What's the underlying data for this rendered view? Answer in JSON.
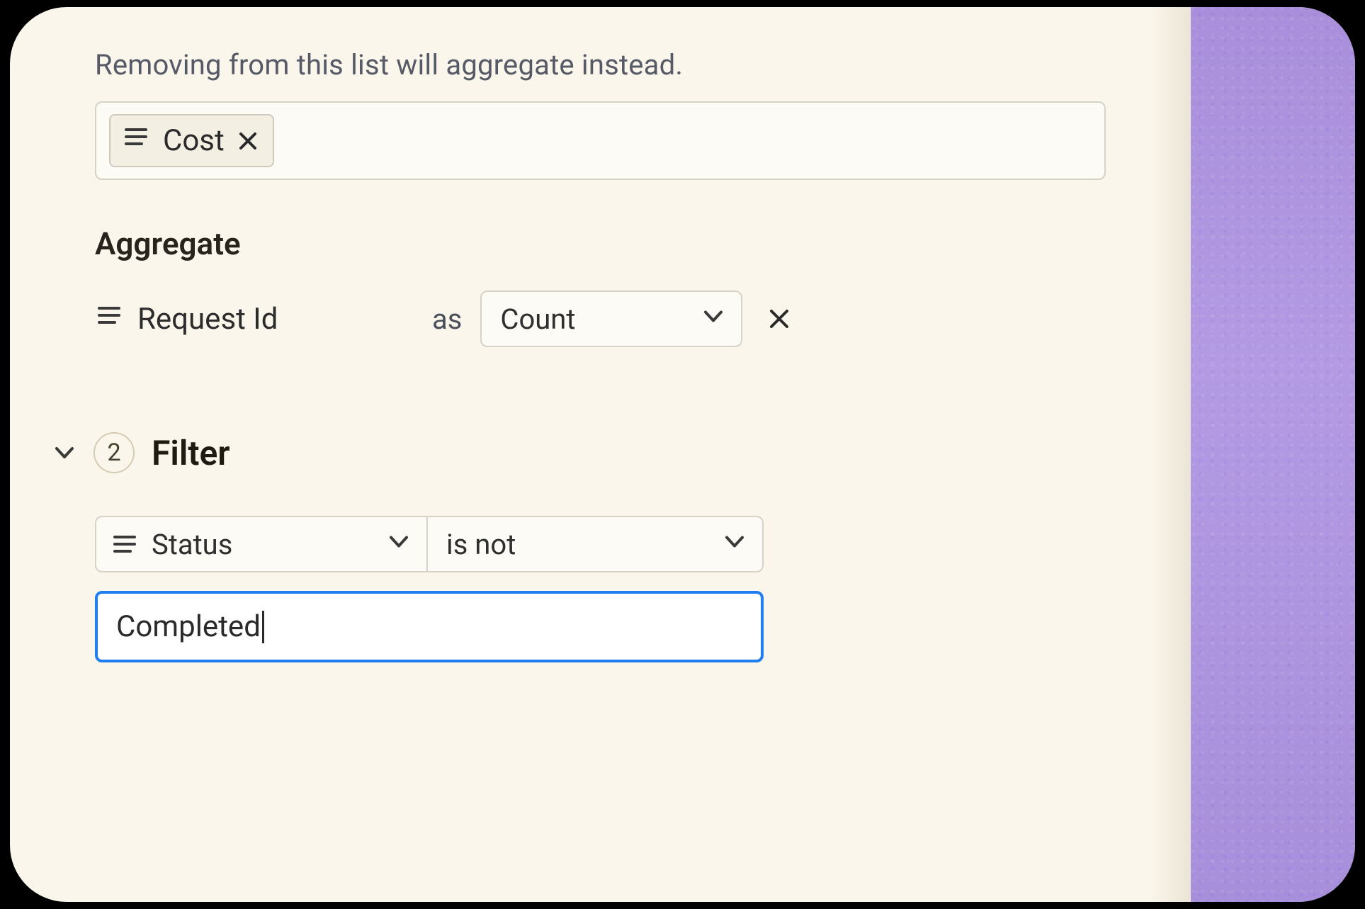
{
  "groupby": {
    "helper_text": "Removing from this list will aggregate instead.",
    "chips": [
      {
        "label": "Cost"
      }
    ]
  },
  "aggregate": {
    "heading": "Aggregate",
    "field": "Request Id",
    "as_label": "as",
    "function": "Count"
  },
  "filter": {
    "step_number": "2",
    "heading": "Filter",
    "field": "Status",
    "operator": "is not",
    "value": "Completed"
  }
}
